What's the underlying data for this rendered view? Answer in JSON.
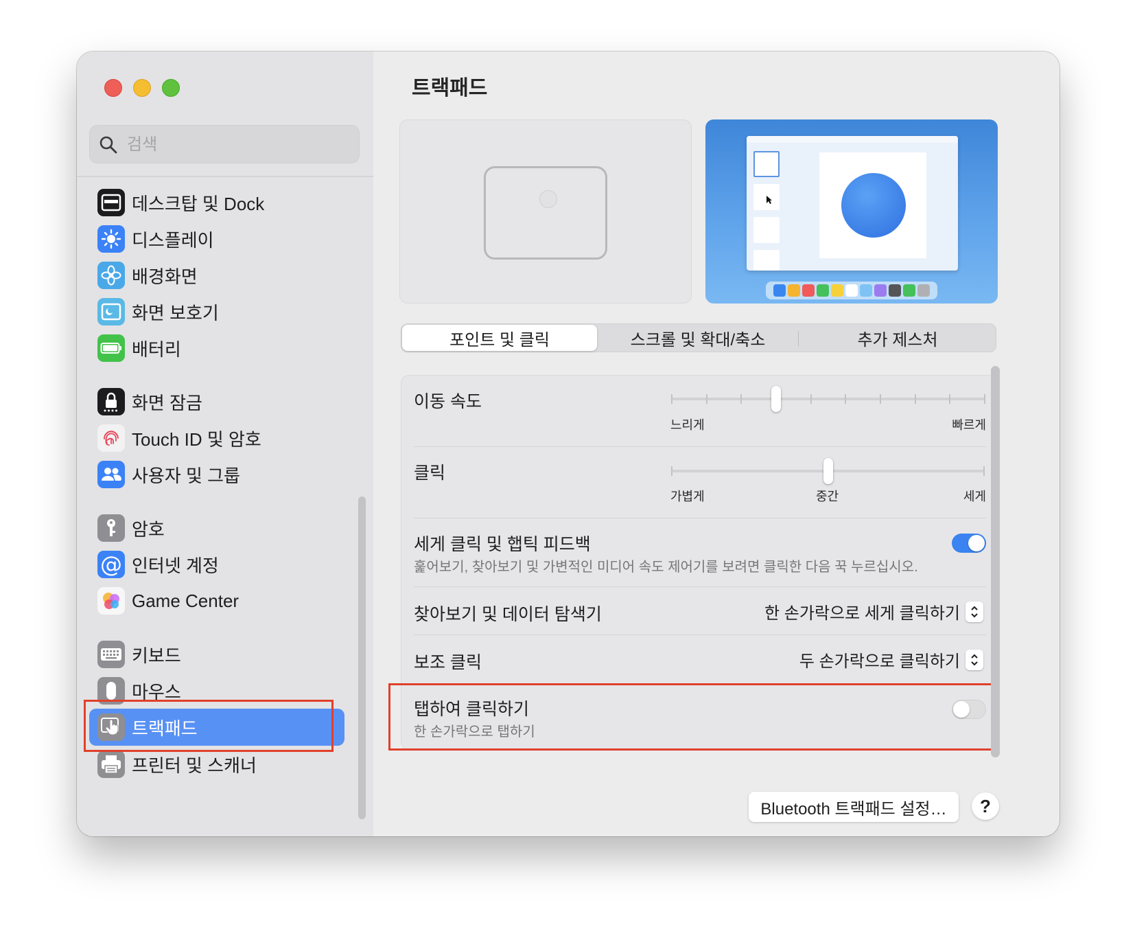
{
  "sidebar": {
    "search_placeholder": "검색",
    "items": [
      {
        "label": "데스크탑 및 Dock",
        "icon": "dock-icon",
        "color": "#1c1c1e"
      },
      {
        "label": "디스플레이",
        "icon": "display-icon",
        "color": "#3b82f6"
      },
      {
        "label": "배경화면",
        "icon": "wallpaper-icon",
        "color": "#4aa8e8"
      },
      {
        "label": "화면 보호기",
        "icon": "screensaver-icon",
        "color": "#5ab9e6"
      },
      {
        "label": "배터리",
        "icon": "battery-icon",
        "color": "#43c24a"
      },
      {
        "label": "화면 잠금",
        "icon": "lock-icon",
        "color": "#1c1c1e"
      },
      {
        "label": "Touch ID 및 암호",
        "icon": "fingerprint-icon",
        "color": "#f2f2f2"
      },
      {
        "label": "사용자 및 그룹",
        "icon": "users-icon",
        "color": "#3b82f6"
      },
      {
        "label": "암호",
        "icon": "key-icon",
        "color": "#8e8e93"
      },
      {
        "label": "인터넷 계정",
        "icon": "at-icon",
        "color": "#3b82f6"
      },
      {
        "label": "Game Center",
        "icon": "game-center-icon",
        "color": "#f7f7f7"
      },
      {
        "label": "키보드",
        "icon": "keyboard-icon",
        "color": "#8e8e93"
      },
      {
        "label": "마우스",
        "icon": "mouse-icon",
        "color": "#8e8e93"
      },
      {
        "label": "트랙패드",
        "icon": "trackpad-icon",
        "color": "#8e8e93"
      },
      {
        "label": "프린터 및 스캐너",
        "icon": "printer-icon",
        "color": "#8e8e93"
      }
    ],
    "selected": "트랙패드"
  },
  "main": {
    "title": "트랙패드",
    "tabs": [
      {
        "label": "포인트 및 클릭",
        "active": true
      },
      {
        "label": "스크롤 및 확대/축소",
        "active": false
      },
      {
        "label": "추가 제스처",
        "active": false
      }
    ],
    "tracking_speed": {
      "label": "이동 속도",
      "min_label": "느리게",
      "max_label": "빠르게",
      "ticks": 10,
      "value_step": 3
    },
    "click": {
      "label": "클릭",
      "labels": [
        "가볍게",
        "중간",
        "세게"
      ],
      "value": "중간"
    },
    "force_click": {
      "label": "세게 클릭 및 햅틱 피드백",
      "description": "훑어보기, 찾아보기 및 가변적인 미디어 속도 제어기를 보려면 클릭한 다음 꾹 누르십시오.",
      "enabled": true
    },
    "lookup": {
      "label": "찾아보기 및 데이터 탐색기",
      "value": "한 손가락으로 세게 클릭하기"
    },
    "secondary_click": {
      "label": "보조 클릭",
      "value": "두 손가락으로 클릭하기"
    },
    "tap_to_click": {
      "label": "탭하여 클릭하기",
      "description": "한 손가락으로 탭하기",
      "enabled": false
    },
    "bluetooth_button": "Bluetooth 트랙패드 설정…",
    "help_button": "?"
  },
  "colors": {
    "accent": "#3a83f1",
    "selection": "#5891f4",
    "highlight_box": "#e0402b"
  }
}
